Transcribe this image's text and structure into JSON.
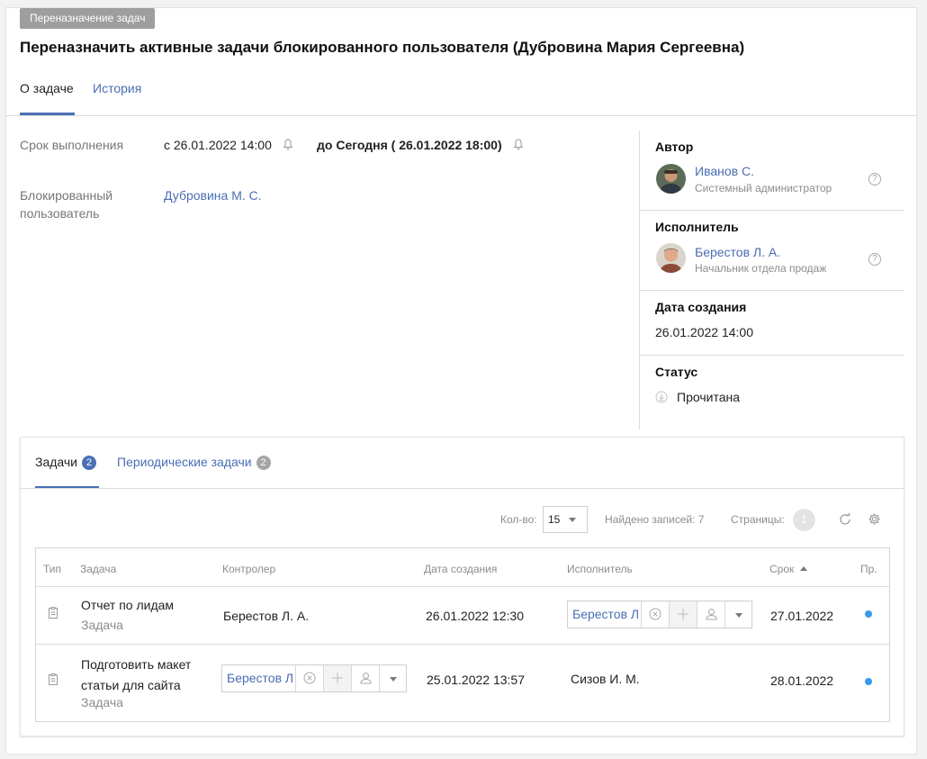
{
  "doc_type": "Переназначение задач",
  "title": "Переназначить активные задачи блокированного пользователя (Дубровина Мария Сергеевна)",
  "tabs": [
    {
      "label": "О задаче",
      "active": true
    },
    {
      "label": "История",
      "active": false
    }
  ],
  "details": {
    "deadline_label": "Срок выполнения",
    "deadline_from": "с 26.01.2022 14:00",
    "deadline_to": "до Сегодня ( 26.01.2022 18:00)",
    "blocked_user_label": "Блокированный пользователь",
    "blocked_user": "Дубровина М. С."
  },
  "side": {
    "author_title": "Автор",
    "author_name": "Иванов С.",
    "author_role": "Системный администратор",
    "executor_title": "Исполнитель",
    "executor_name": "Берестов Л. А.",
    "executor_role": "Начальник отдела продаж",
    "created_title": "Дата создания",
    "created_value": "26.01.2022 14:00",
    "status_title": "Статус",
    "status_value": "Прочитана",
    "help_glyph": "?"
  },
  "task_tabs": [
    {
      "label": "Задачи",
      "count": "2",
      "active": true
    },
    {
      "label": "Периодические задачи",
      "count": "2",
      "active": false
    }
  ],
  "pager": {
    "qty_label": "Кол-во:",
    "qty_value": "15",
    "found": "Найдено записей: 7",
    "pages_label": "Страницы:",
    "page": "1"
  },
  "table": {
    "headers": {
      "type": "Тип",
      "task": "Задача",
      "controller": "Контролер",
      "created": "Дата создания",
      "executor": "Исполнитель",
      "deadline": "Срок",
      "priority": "Пр."
    },
    "rows": [
      {
        "task": "Отчет по лидам",
        "task_type": "Задача",
        "controller": "Берестов Л. А.",
        "created": "26.01.2022 12:30",
        "executor": "Берестов Л",
        "deadline": "27.01.2022"
      },
      {
        "task": "Подготовить макет статьи для сайта",
        "task_type": "Задача",
        "controller": "Берестов Л",
        "created": "25.01.2022 13:57",
        "executor": "Сизов И. М.",
        "deadline": "28.01.2022"
      }
    ]
  },
  "colors": {
    "accent": "#4b70b6",
    "link": "#4a6eb3",
    "priority_dot": "#3a99ea",
    "badge_active": "#4b70b6",
    "badge_inactive": "#a5a5a5"
  }
}
